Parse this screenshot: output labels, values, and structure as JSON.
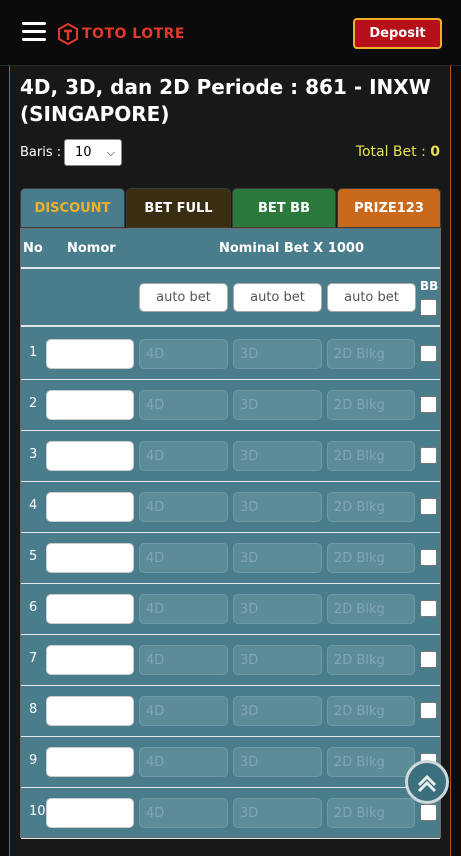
{
  "header": {
    "logo_text": "TOTO LOTRE",
    "deposit_label": "Deposit"
  },
  "page": {
    "title": "4D, 3D, dan 2D Periode : 861 - INXW (SINGAPORE)",
    "baris_label": "Baris :",
    "baris_value": "10",
    "total_bet_label": "Total Bet :",
    "total_bet_value": "0"
  },
  "tabs": [
    {
      "label": "DISCOUNT"
    },
    {
      "label": "BET FULL"
    },
    {
      "label": "BET BB"
    },
    {
      "label": "PRIZE123"
    }
  ],
  "table": {
    "col_no": "No",
    "col_nomor": "Nomor",
    "col_nominal": "Nominal Bet X 1000",
    "auto_bet_placeholder": "auto bet",
    "bb_label": "BB",
    "placeholders": {
      "d4": "4D",
      "d3": "3D",
      "d2": "2D Blkg"
    },
    "rows": [
      "1",
      "2",
      "3",
      "4",
      "5",
      "6",
      "7",
      "8",
      "9",
      "10"
    ]
  },
  "colors": {
    "brand_red": "#b8101a",
    "accent_gold": "#f0b12a",
    "table_teal": "#4a7d8c",
    "total_yellow": "#e5e054"
  },
  "icons": [
    "menu-icon",
    "logo-icon",
    "chevron-down-icon",
    "scroll-top-icon"
  ]
}
